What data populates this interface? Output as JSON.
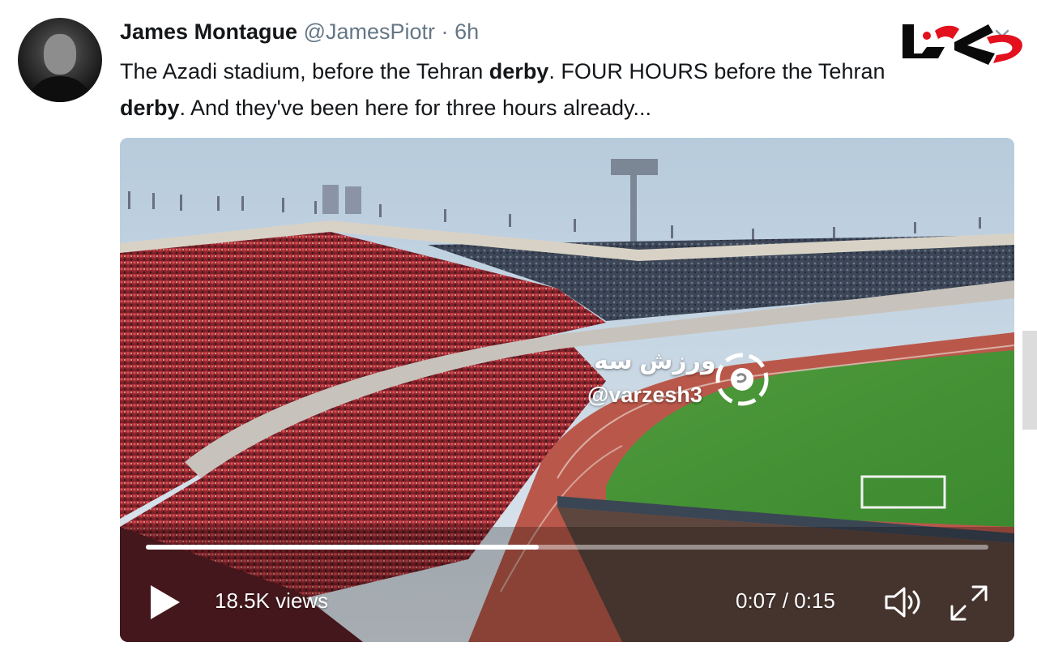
{
  "tweet": {
    "author_name": "James Montague",
    "author_handle": "@JamesPiotr",
    "separator": "·",
    "time_ago": "6h",
    "text_parts": [
      "The Azadi stadium, before the Tehran ",
      "derby",
      ". FOUR HOURS before the Tehran ",
      "derby",
      ". And they've been here for three hours already..."
    ]
  },
  "watermark": {
    "persian": "ورزش سه",
    "handle": "@varzesh3"
  },
  "video": {
    "views": "18.5K views",
    "timecode": "0:07 / 0:15",
    "progress_fraction": 0.466
  },
  "icons": {
    "more": "chevron-down-icon",
    "play": "play-icon",
    "volume": "volume-icon",
    "fullscreen": "fullscreen-icon"
  },
  "colors": {
    "text": "#14171a",
    "muted": "#657786",
    "brand_red": "#e3101e"
  }
}
